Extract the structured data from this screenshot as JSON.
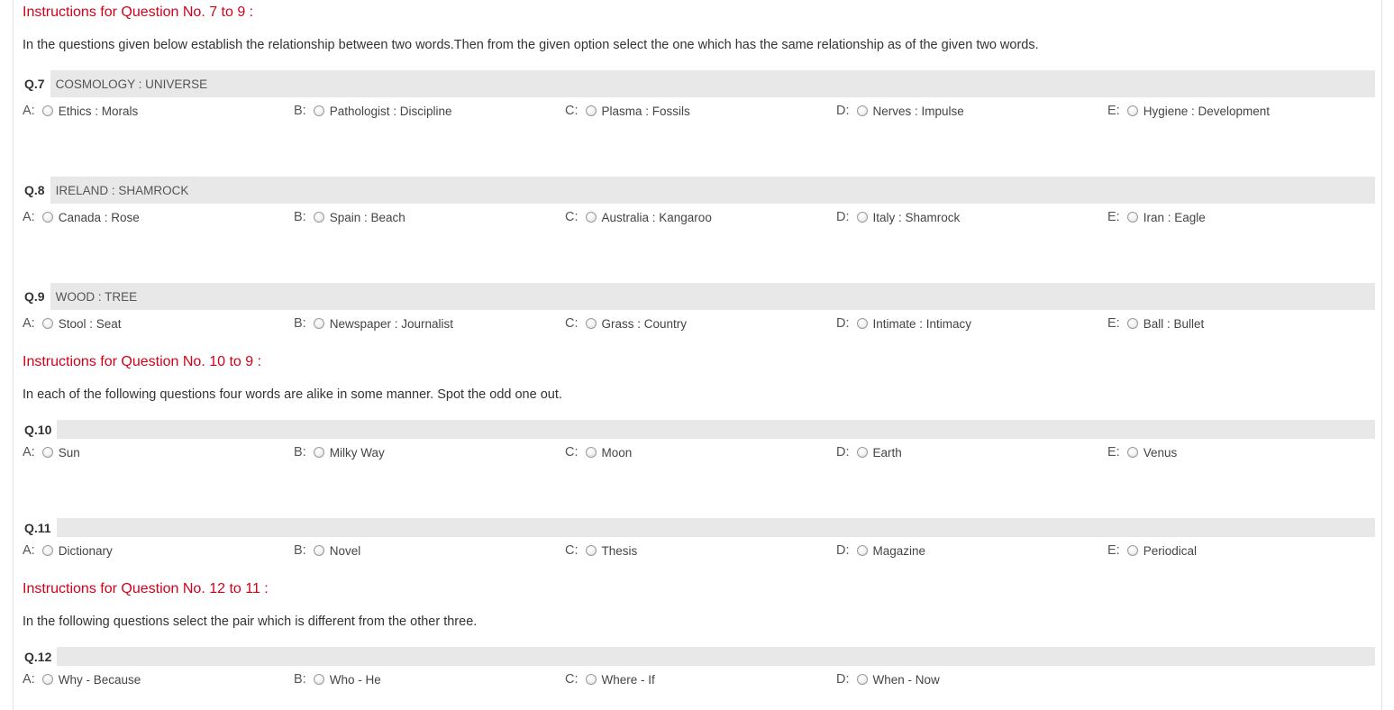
{
  "sections": [
    {
      "title": "Instructions for Question No. 7 to 9 :",
      "text": "In the questions given below establish the relationship between two words.Then from the given option select the one which has the same relationship as of the given two words.",
      "questions": [
        {
          "number": "Q.7",
          "text": "COSMOLOGY : UNIVERSE",
          "options": [
            {
              "letter": "A:",
              "text": "Ethics : Morals"
            },
            {
              "letter": "B:",
              "text": "Pathologist : Discipline"
            },
            {
              "letter": "C:",
              "text": "Plasma : Fossils"
            },
            {
              "letter": "D:",
              "text": "Nerves : Impulse"
            },
            {
              "letter": "E:",
              "text": "Hygiene : Development"
            }
          ]
        },
        {
          "number": "Q.8",
          "text": "IRELAND : SHAMROCK",
          "options": [
            {
              "letter": "A:",
              "text": "Canada : Rose"
            },
            {
              "letter": "B:",
              "text": "Spain : Beach"
            },
            {
              "letter": "C:",
              "text": "Australia : Kangaroo"
            },
            {
              "letter": "D:",
              "text": "Italy : Shamrock"
            },
            {
              "letter": "E:",
              "text": "Iran : Eagle"
            }
          ]
        },
        {
          "number": "Q.9",
          "text": "WOOD : TREE",
          "options": [
            {
              "letter": "A:",
              "text": "Stool : Seat"
            },
            {
              "letter": "B:",
              "text": "Newspaper : Journalist"
            },
            {
              "letter": "C:",
              "text": "Grass : Country"
            },
            {
              "letter": "D:",
              "text": "Intimate : Intimacy"
            },
            {
              "letter": "E:",
              "text": "Ball : Bullet"
            }
          ]
        }
      ]
    },
    {
      "title": "Instructions for Question No. 10 to 9 :",
      "text": "In each of the following questions four words are alike in some manner. Spot the odd one out.",
      "questions": [
        {
          "number": "Q.10",
          "text": "",
          "options": [
            {
              "letter": "A:",
              "text": "Sun"
            },
            {
              "letter": "B:",
              "text": "Milky Way"
            },
            {
              "letter": "C:",
              "text": "Moon"
            },
            {
              "letter": "D:",
              "text": "Earth"
            },
            {
              "letter": "E:",
              "text": "Venus"
            }
          ]
        },
        {
          "number": "Q.11",
          "text": "",
          "options": [
            {
              "letter": "A:",
              "text": "Dictionary"
            },
            {
              "letter": "B:",
              "text": "Novel"
            },
            {
              "letter": "C:",
              "text": "Thesis"
            },
            {
              "letter": "D:",
              "text": "Magazine"
            },
            {
              "letter": "E:",
              "text": "Periodical"
            }
          ]
        }
      ]
    },
    {
      "title": "Instructions for Question No. 12 to 11 :",
      "text": "In the following questions select the pair which is different from the other three.",
      "questions": [
        {
          "number": "Q.12",
          "text": "",
          "options": [
            {
              "letter": "A:",
              "text": "Why - Because"
            },
            {
              "letter": "B:",
              "text": "Who - He"
            },
            {
              "letter": "C:",
              "text": "Where - If"
            },
            {
              "letter": "D:",
              "text": "When - Now"
            }
          ]
        }
      ]
    }
  ]
}
